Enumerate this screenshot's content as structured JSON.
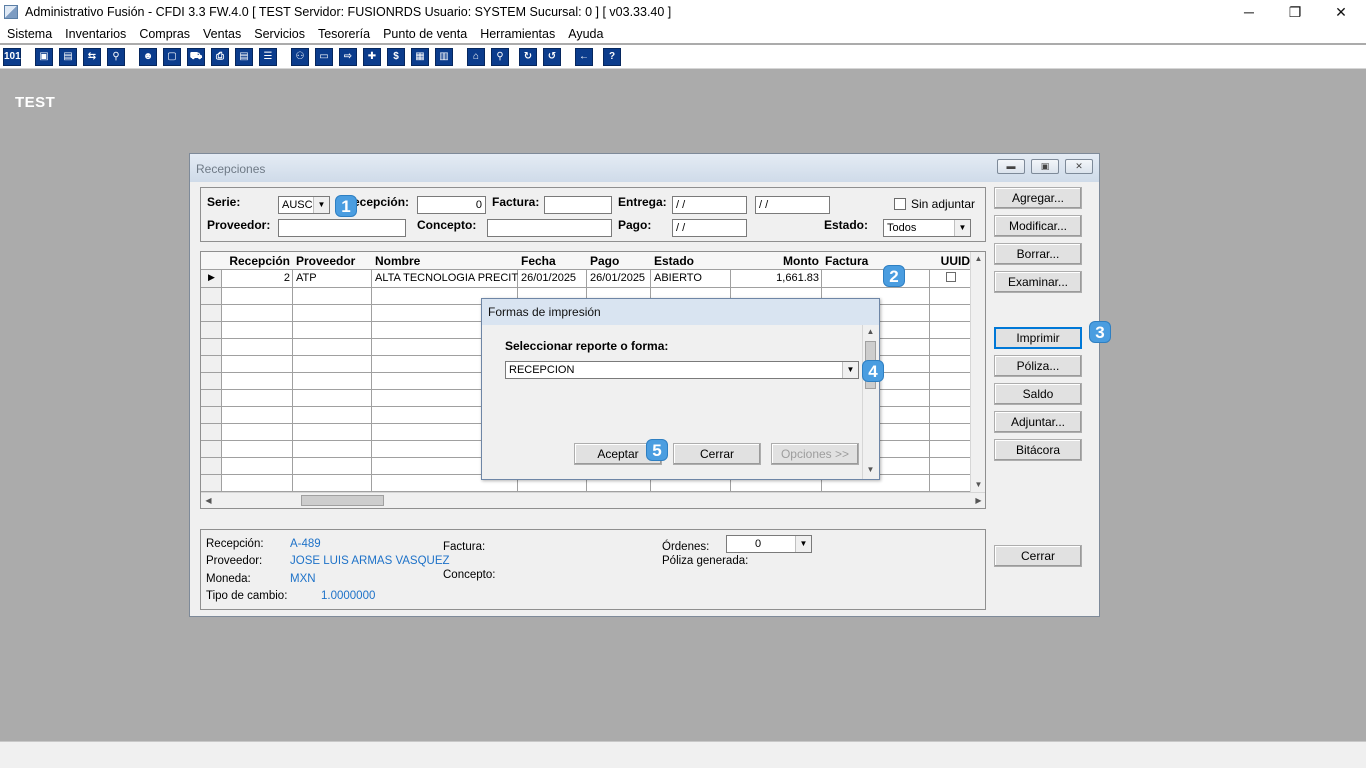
{
  "window": {
    "title": "Administrativo Fusión - CFDI 3.3 FW.4.0 [ TEST   Servidor: FUSIONRDS    Usuario: SYSTEM      Sucursal: 0 ] [ v03.33.40 ]",
    "minimize": "─",
    "restore": "❐",
    "close": "✕"
  },
  "menu": [
    "Sistema",
    "Inventarios",
    "Compras",
    "Ventas",
    "Servicios",
    "Tesorería",
    "Punto de venta",
    "Herramientas",
    "Ayuda"
  ],
  "toolbar": {
    "icons": [
      "calculator-icon",
      "window-icon",
      "clipboard-icon",
      "swap-icon",
      "search-doc-icon",
      "user-icon",
      "folder-icon",
      "truck-icon",
      "printer-icon",
      "document-icon",
      "list-icon",
      "binoculars-icon",
      "box-icon",
      "export-icon",
      "add-icon",
      "money-icon",
      "book-icon",
      "table-icon",
      "home-icon",
      "zoom-icon",
      "refresh-icon",
      "undo-icon",
      "back-icon",
      "help-icon"
    ],
    "glyphs": [
      "101",
      "▣",
      "▤",
      "⇆",
      "⚲",
      "☻",
      "▢",
      "⛟",
      "⎙",
      "▤",
      "☰",
      "⚇",
      "▭",
      "⇨",
      "✚",
      "$",
      "▦",
      "▥",
      "⌂",
      "⚲",
      "↻",
      "↺",
      "←",
      "?"
    ]
  },
  "desktop_label": "TEST",
  "recepciones": {
    "title": "Recepciones",
    "ctl": {
      "min": "▬",
      "max": "▣",
      "close": "✕"
    },
    "filter": {
      "serie_label": "Serie:",
      "serie_value": "AUSC",
      "recepcion_label": "ecepción:",
      "recepcion_value": "0",
      "factura_label": "Factura:",
      "factura_value": "",
      "entrega_label": "Entrega:",
      "entrega_from": " /  /",
      "entrega_to": " /  /",
      "sin_adjuntar_label": "Sin adjuntar",
      "proveedor_label": "Proveedor:",
      "proveedor_value": "",
      "concepto_label": "Concepto:",
      "concepto_value": "",
      "pago_label": "Pago:",
      "pago_value": " /  /",
      "estado_label": "Estado:",
      "estado_value": "Todos"
    },
    "buttons": {
      "agregar": "Agregar...",
      "modificar": "Modificar...",
      "borrar": "Borrar...",
      "examinar": "Examinar...",
      "imprimir": "Imprimir",
      "poliza": "Póliza...",
      "saldo": "Saldo",
      "adjuntar": "Adjuntar...",
      "bitacora": "Bitácora",
      "cerrar": "Cerrar"
    },
    "grid": {
      "columns": [
        "Recepción",
        "Proveedor",
        "Nombre",
        "Fecha",
        "Pago",
        "Estado",
        "Monto",
        "Factura",
        "UUID"
      ],
      "rows": [
        [
          "2",
          "ATP",
          "ALTA TECNOLOGIA PRECITC",
          "26/01/2025",
          "26/01/2025",
          "ABIERTO",
          "1,661.83",
          "",
          ""
        ]
      ],
      "current_row_marker": "▶"
    },
    "info": {
      "recepcion_label": "Recepción:",
      "recepcion_value": "A-489",
      "proveedor_label": "Proveedor:",
      "proveedor_value": "JOSE LUIS ARMAS VASQUEZ",
      "moneda_label": "Moneda:",
      "moneda_value": "MXN",
      "tipo_cambio_label": "Tipo de cambio:",
      "tipo_cambio_value": "1.0000000",
      "factura_label": "Factura:",
      "concepto_label": "Concepto:",
      "ordenes_label": "Órdenes:",
      "ordenes_value": "0",
      "poliza_generada_label": "Póliza generada:"
    }
  },
  "dialog": {
    "title": "Formas de impresión",
    "select_label": "Seleccionar reporte o forma:",
    "select_value": "RECEPCION",
    "aceptar": "Aceptar",
    "cerrar": "Cerrar",
    "opciones": "Opciones >>"
  },
  "badges": [
    "1",
    "2",
    "3",
    "4",
    "5"
  ],
  "colors": {
    "accent_badge": "#4a9de0",
    "info_value": "#1e72c8",
    "toolbar_icon": "#0b3c8c"
  }
}
